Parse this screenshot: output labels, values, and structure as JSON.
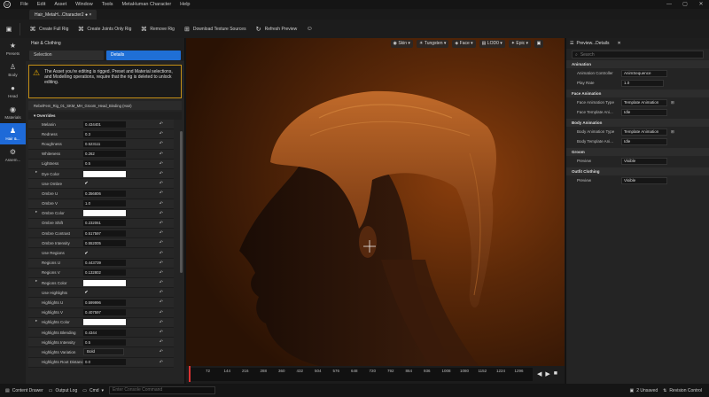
{
  "menu": {
    "items": [
      "File",
      "Edit",
      "Asset",
      "Window",
      "Tools",
      "MetaHuman Character",
      "Help"
    ]
  },
  "tab": {
    "title": "Hair_MetaH...Character2 ● ×"
  },
  "toolbar": {
    "create_full_rig": "Create Full Rig",
    "create_joints_rig": "Create Joints Only Rig",
    "remove_rig": "Remove Rig",
    "download_textures": "Download Texture Sources",
    "refresh_preview": "Refresh Preview"
  },
  "left_strip": [
    {
      "label": "Presets",
      "icon": "star-icon"
    },
    {
      "label": "Body",
      "icon": "body-icon"
    },
    {
      "label": "Head",
      "icon": "head-icon"
    },
    {
      "label": "Materials",
      "icon": "materials-icon"
    },
    {
      "label": "Hair &...",
      "icon": "hair-icon"
    },
    {
      "label": "Assem...",
      "icon": "assembly-icon"
    }
  ],
  "left_panel": {
    "title": "Hair & Clothing",
    "tab_selection": "Selection",
    "tab_details": "Details",
    "warning": "The Asset you're editing is rigged. Preset and Material selections, and Modelling operations, require that the rig is deleted to unlock editing.",
    "asset_name": "RebelFem_Rig_01_SKM_MH_Groom_Head_Binding (Hair)",
    "section": "Overrides"
  },
  "overrides": [
    {
      "label": "Melanin",
      "value": "0.434401",
      "kind": "num"
    },
    {
      "label": "Redness",
      "value": "0.3",
      "kind": "num"
    },
    {
      "label": "Roughness",
      "value": "0.523111",
      "kind": "num"
    },
    {
      "label": "Whiteness",
      "value": "0.262",
      "kind": "num"
    },
    {
      "label": "Lightness",
      "value": "0.5",
      "kind": "num"
    },
    {
      "label": "Dye Color",
      "value": "",
      "kind": "color"
    },
    {
      "label": "Use Ombre",
      "value": "✔",
      "kind": "check"
    },
    {
      "label": "Ombre U",
      "value": "0.356806",
      "kind": "num"
    },
    {
      "label": "Ombre V",
      "value": "1.0",
      "kind": "num"
    },
    {
      "label": "Ombre Color",
      "value": "",
      "kind": "color"
    },
    {
      "label": "Ombre Shift",
      "value": "0.232061",
      "kind": "num"
    },
    {
      "label": "Ombre Contrast",
      "value": "0.517597",
      "kind": "num"
    },
    {
      "label": "Ombre Intensity",
      "value": "0.552005",
      "kind": "num"
    },
    {
      "label": "Use Regions",
      "value": "✔",
      "kind": "check"
    },
    {
      "label": "Regions U",
      "value": "0.443739",
      "kind": "num"
    },
    {
      "label": "Regions V",
      "value": "0.132802",
      "kind": "num"
    },
    {
      "label": "Regions Color",
      "value": "",
      "kind": "color"
    },
    {
      "label": "Use Highlights",
      "value": "✔",
      "kind": "check"
    },
    {
      "label": "Highlights U",
      "value": "0.599996",
      "kind": "num"
    },
    {
      "label": "Highlights V",
      "value": "0.407597",
      "kind": "num"
    },
    {
      "label": "Highlights Color",
      "value": "",
      "kind": "color"
    },
    {
      "label": "Highlights Blending",
      "value": "0.4344",
      "kind": "num"
    },
    {
      "label": "Highlights Intensity",
      "value": "0.5",
      "kind": "num"
    },
    {
      "label": "Highlights Variation",
      "value": "Bold",
      "kind": "dropdown"
    },
    {
      "label": "Highlights Root Distance",
      "value": "0.0",
      "kind": "num"
    }
  ],
  "viewport": {
    "buttons": [
      "Skin",
      "Tungsten",
      "Face",
      "LOD0",
      "Epic"
    ]
  },
  "timeline": {
    "ticks": [
      "72",
      "144",
      "216",
      "288",
      "360",
      "432",
      "504",
      "576",
      "648",
      "720",
      "792",
      "864",
      "936",
      "1008",
      "1080",
      "1152",
      "1224",
      "1296"
    ]
  },
  "right_panel": {
    "tab": "Preview...Details",
    "search_placeholder": "Search",
    "sections": [
      {
        "title": "Animation",
        "rows": [
          {
            "key": "Animation Controller",
            "value": "AnimSequence"
          },
          {
            "key": "Play Rate",
            "value": "1.0"
          }
        ]
      },
      {
        "title": "Face Animation",
        "rows": [
          {
            "key": "Face Animation Type",
            "value": "Template Animation"
          },
          {
            "key": "Face Template Ani...",
            "value": "Idle"
          }
        ]
      },
      {
        "title": "Body Animation",
        "rows": [
          {
            "key": "Body Animation Type",
            "value": "Template Animation"
          },
          {
            "key": "Body Template Ani...",
            "value": "Idle"
          }
        ]
      },
      {
        "title": "Groom",
        "rows": [
          {
            "key": "Preview",
            "value": "Visible"
          }
        ]
      },
      {
        "title": "Outfit Clothing",
        "rows": [
          {
            "key": "Preview",
            "value": "Visible"
          }
        ]
      }
    ]
  },
  "status": {
    "content_drawer": "Content Drawer",
    "output_log": "Output Log",
    "cmd": "Cmd",
    "cmd_placeholder": "Enter Console Command",
    "unsaved": "2 Unsaved",
    "revision": "Revision Control"
  }
}
